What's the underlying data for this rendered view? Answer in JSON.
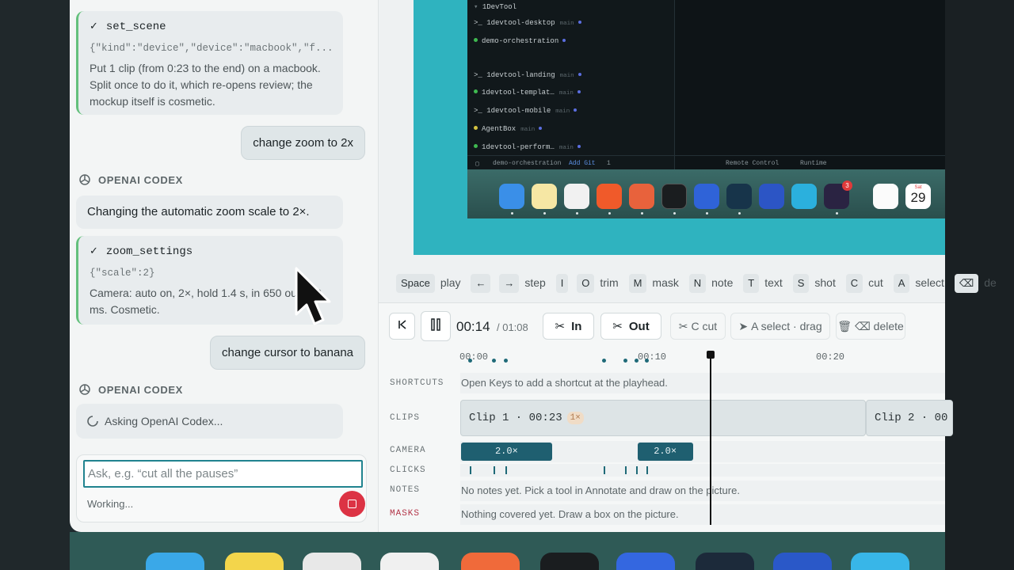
{
  "chat": {
    "messages": {
      "tool1_name": "set_scene",
      "tool1_args": "{\"kind\":\"device\",\"device\":\"macbook\",\"f...",
      "tool1_desc": "Put 1 clip (from 0:23 to the end) on a macbook. Split once to do it, which re-opens review; the mockup itself is cosmetic.",
      "user1": "change zoom to 2x",
      "sender": "OPENAI CODEX",
      "assist1": "Changing the automatic zoom scale to 2×.",
      "tool2_name": "zoom_settings",
      "tool2_args": "{\"scale\":2}",
      "tool2_desc": "Camera: auto on, 2×, hold 1.4 s, in 650 out 750 ms. Cosmetic.",
      "user2": "change cursor to banana",
      "sender2": "OPENAI CODEX",
      "assist2": "Asking OpenAI Codex..."
    },
    "composer": {
      "placeholder": "Ask, e.g. “cut all the pauses”",
      "status": "Working..."
    }
  },
  "preview": {
    "sidebar": {
      "group": "1DevTool",
      "repos": [
        {
          "name": "1devtool-desktop",
          "branch": "main"
        },
        {
          "name": "demo-orchestration",
          "branch": ""
        },
        {
          "name": "1devtool-landing",
          "branch": "main"
        },
        {
          "name": "1devtool-templat…",
          "branch": "main"
        },
        {
          "name": "1devtool-mobile",
          "branch": "main"
        },
        {
          "name": "AgentBox",
          "branch": "main"
        },
        {
          "name": "1devtool-perform…",
          "branch": "main"
        }
      ]
    },
    "status": {
      "project": "demo-orchestration",
      "add_git": "Add Git",
      "count": "1",
      "remote": "Remote Control",
      "runtime": "Runtime"
    },
    "dock": {
      "badge": "3",
      "calendar_month": "Sat",
      "calendar_day": "29"
    }
  },
  "shortcuts": [
    {
      "key": "Space",
      "label": "play"
    },
    {
      "key": "←",
      "label": ""
    },
    {
      "key": "→",
      "label": "step"
    },
    {
      "key": "I",
      "label": ""
    },
    {
      "key": "O",
      "label": "trim"
    },
    {
      "key": "M",
      "label": "mask"
    },
    {
      "key": "N",
      "label": "note"
    },
    {
      "key": "T",
      "label": "text"
    },
    {
      "key": "S",
      "label": "shot"
    },
    {
      "key": "C",
      "label": "cut"
    },
    {
      "key": "A",
      "label": "select"
    },
    {
      "key": "⌫",
      "label": "de"
    }
  ],
  "timeline": {
    "time_current": "00:14",
    "time_total": "/ 01:08",
    "in_label": "In",
    "out_label": "Out",
    "cut_label": "C cut",
    "select_label": "A select · drag",
    "delete_label": "⌫ delete",
    "ticks": [
      "00:00",
      "00:10",
      "00:20"
    ],
    "playhead_seconds": 14,
    "tracks": {
      "shortcuts_label": "SHORTCUTS",
      "shortcuts_text": "Open Keys to add a shortcut at the playhead.",
      "clips_label": "CLIPS",
      "clip1": "Clip 1 · 00:23",
      "clip1_badge": "1×",
      "clip2": "Clip 2 · 00",
      "camera_label": "CAMERA",
      "camera_segments": [
        {
          "label": "2.0×",
          "start": 0,
          "end": 5.1
        },
        {
          "label": "2.0×",
          "start": 9.9,
          "end": 13.0
        }
      ],
      "clicks_label": "CLICKS",
      "clicks": [
        0.5,
        1.8,
        2.5,
        8.0,
        9.2,
        9.8,
        10.4
      ],
      "notes_label": "NOTES",
      "notes_text": "No notes yet. Pick a tool in Annotate and draw on the picture.",
      "masks_label": "MASKS",
      "masks_text": "Nothing covered yet. Draw a box on the picture."
    }
  },
  "colors": {
    "accent": "#20838f",
    "tool_border": "#63c07c",
    "stop": "#dc3344",
    "camera": "#1f5f70",
    "masks_label": "#b3374a"
  }
}
